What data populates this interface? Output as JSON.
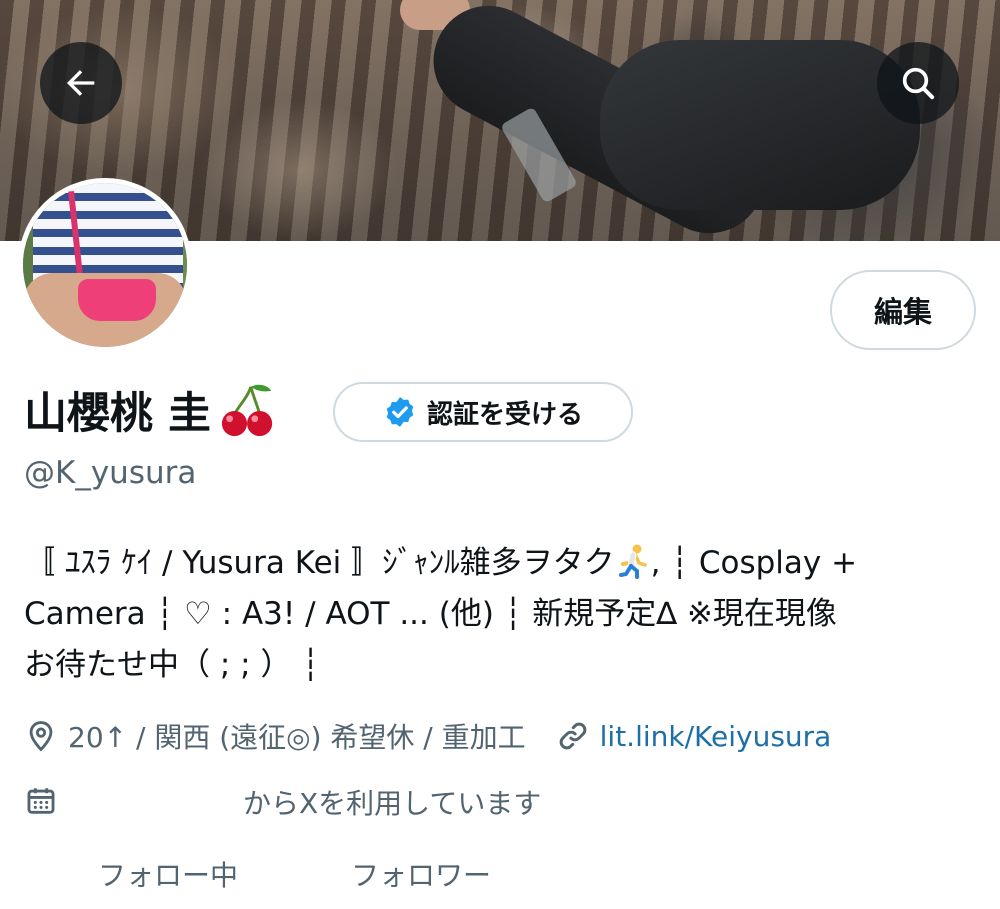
{
  "header": {
    "back_icon": "arrow-left-icon",
    "search_icon": "search-icon"
  },
  "profile": {
    "display_name": "山櫻桃 圭",
    "name_emoji": "cherry-icon",
    "handle": "@K_yusura",
    "edit_label": "編集",
    "verify_label": "認証を受ける",
    "bio_line1_a": "〚 ﾕｽﾗ ｹｲ / Yusura Kei 〛ｼﾞｬﾝﾙ雑多ヲタク",
    "bio_line1_b": ", ┆ Cosplay +",
    "bio_line2": "Camera ┆ ♡ : A3! / AOT ... (他) ┆ 新規予定∆ ※現在現像",
    "bio_line3": "お待たせ中（ ; ; ） ┆",
    "location": "20↑ / 関西 (遠征◎) 希望休 / 重加工",
    "website": "lit.link/Keiyusura",
    "joined": "からXを利用しています",
    "following_label": "フォロー中",
    "followers_label": "フォロワー"
  },
  "colors": {
    "text_primary": "#0f1419",
    "text_secondary": "#536471",
    "link": "#1d6fa5",
    "verified_blue": "#1d9bf0",
    "border": "#cfd9de"
  }
}
